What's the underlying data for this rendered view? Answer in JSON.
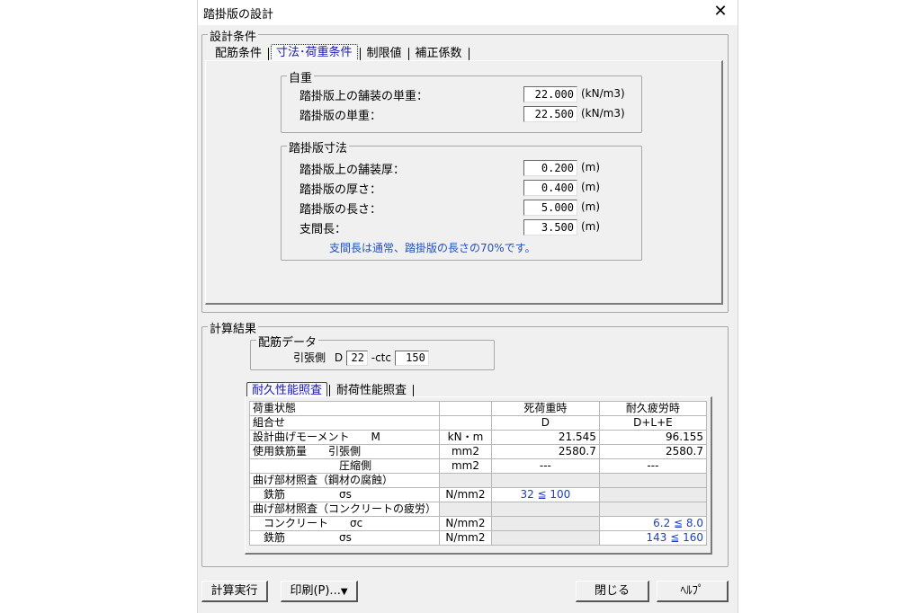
{
  "window": {
    "title": "踏掛版の設計",
    "close_glyph": "✕"
  },
  "design_conditions": {
    "label": "設計条件",
    "tabs": [
      "配筋条件",
      "寸法･荷重条件",
      "制限値",
      "補正係数"
    ],
    "self_weight": {
      "label": "自重",
      "rows": [
        {
          "label": "踏掛版上の舗装の単重：",
          "value": "22.000",
          "unit": "(kN/m3)"
        },
        {
          "label": "踏掛版の単重：",
          "value": "22.500",
          "unit": "(kN/m3)"
        }
      ]
    },
    "dimensions": {
      "label": "踏掛版寸法",
      "rows": [
        {
          "label": "踏掛版上の舗装厚：",
          "value": "0.200",
          "unit": "(m)"
        },
        {
          "label": "踏掛版の厚さ：",
          "value": "0.400",
          "unit": "(m)"
        },
        {
          "label": "踏掛版の長さ：",
          "value": "5.000",
          "unit": "(m)"
        },
        {
          "label": "支間長：",
          "value": "3.500",
          "unit": "(m)"
        }
      ],
      "note": "支間長は通常、踏掛版の長さの70%です。"
    }
  },
  "results": {
    "label": "計算結果",
    "rebar": {
      "label": "配筋データ",
      "tension_label": "引張側",
      "d_prefix": "D",
      "diameter": "22",
      "ctc_label": "-ctc",
      "ctc": "150"
    },
    "tabs": [
      "耐久性能照査",
      "耐荷性能照査"
    ],
    "table": {
      "header": [
        "荷重状態",
        "",
        "死荷重時",
        "耐久疲労時"
      ],
      "rows": [
        [
          "組合せ",
          "",
          "D",
          "D+L+E"
        ],
        [
          "設計曲げモーメント　　M",
          "kN・m",
          "21.545",
          "96.155"
        ],
        [
          "使用鉄筋量　　引張側",
          "mm2",
          "2580.7",
          "2580.7"
        ],
        [
          "　　　　　　　　圧縮側",
          "mm2",
          "---",
          "---"
        ],
        [
          "曲げ部材照査（鋼材の腐蝕）",
          "",
          "",
          ""
        ],
        [
          "　鉄筋　　　　　σs",
          "N/mm2",
          "32 ≦ 100",
          ""
        ],
        [
          "曲げ部材照査（コンクリートの疲労）",
          "",
          "",
          ""
        ],
        [
          "　コンクリート　　σc",
          "N/mm2",
          "",
          "6.2 ≦ 8.0"
        ],
        [
          "　鉄筋　　　　　σs",
          "N/mm2",
          "",
          "143 ≦ 160"
        ]
      ]
    }
  },
  "buttons": {
    "run": "計算実行",
    "print": "印刷(P)...",
    "print_arrow": "▼",
    "close": "閉じる",
    "help": "ﾍﾙﾌﾟ"
  }
}
